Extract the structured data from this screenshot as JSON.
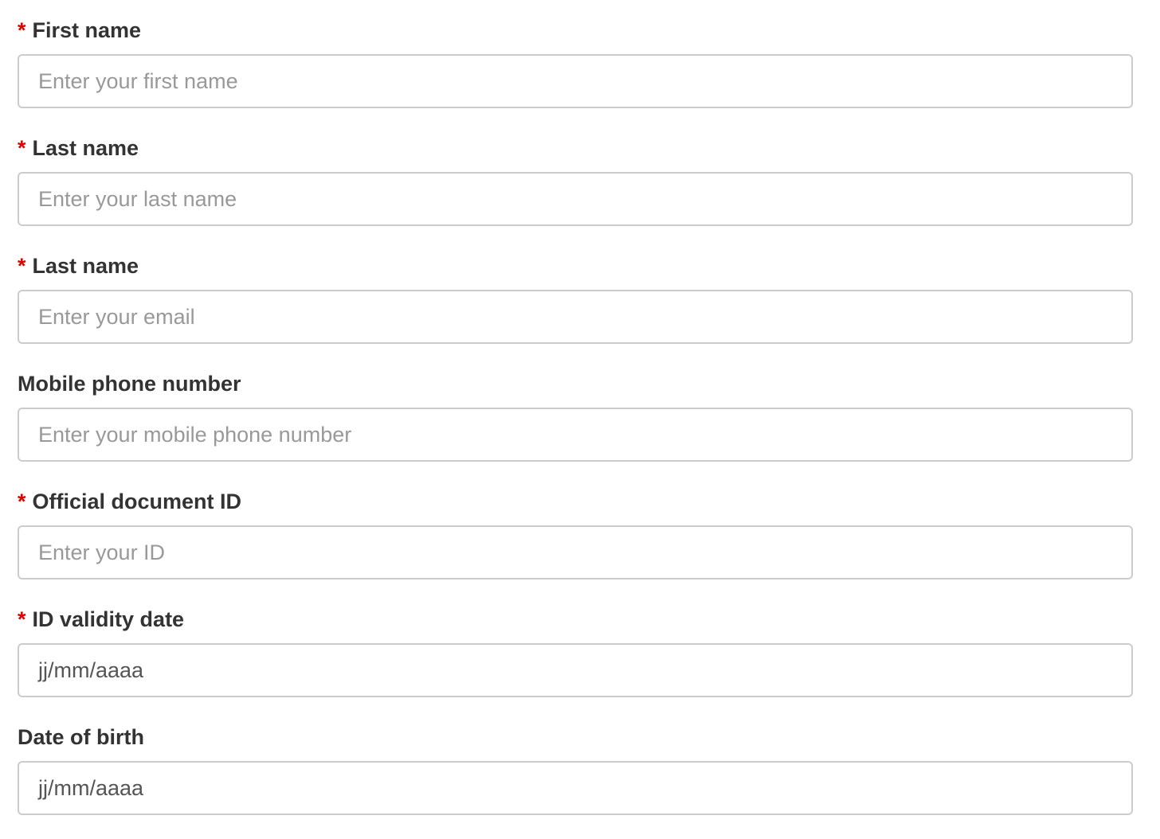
{
  "form": {
    "required_marker": "*",
    "fields": [
      {
        "label": "First name",
        "required": true,
        "placeholder": "Enter your first name"
      },
      {
        "label": "Last name",
        "required": true,
        "placeholder": "Enter your last name"
      },
      {
        "label": "Last name",
        "required": true,
        "placeholder": "Enter your email"
      },
      {
        "label": "Mobile phone number",
        "required": false,
        "placeholder": "Enter your mobile phone number"
      },
      {
        "label": "Official document ID",
        "required": true,
        "placeholder": "Enter your ID"
      },
      {
        "label": "ID validity date",
        "required": true,
        "value": "jj/mm/aaaa"
      },
      {
        "label": "Date of birth",
        "required": false,
        "value": "jj/mm/aaaa"
      }
    ]
  },
  "colors": {
    "required_marker": "#e00000",
    "label_text": "#333333",
    "placeholder_text": "#999999",
    "input_border": "#cccccc"
  }
}
